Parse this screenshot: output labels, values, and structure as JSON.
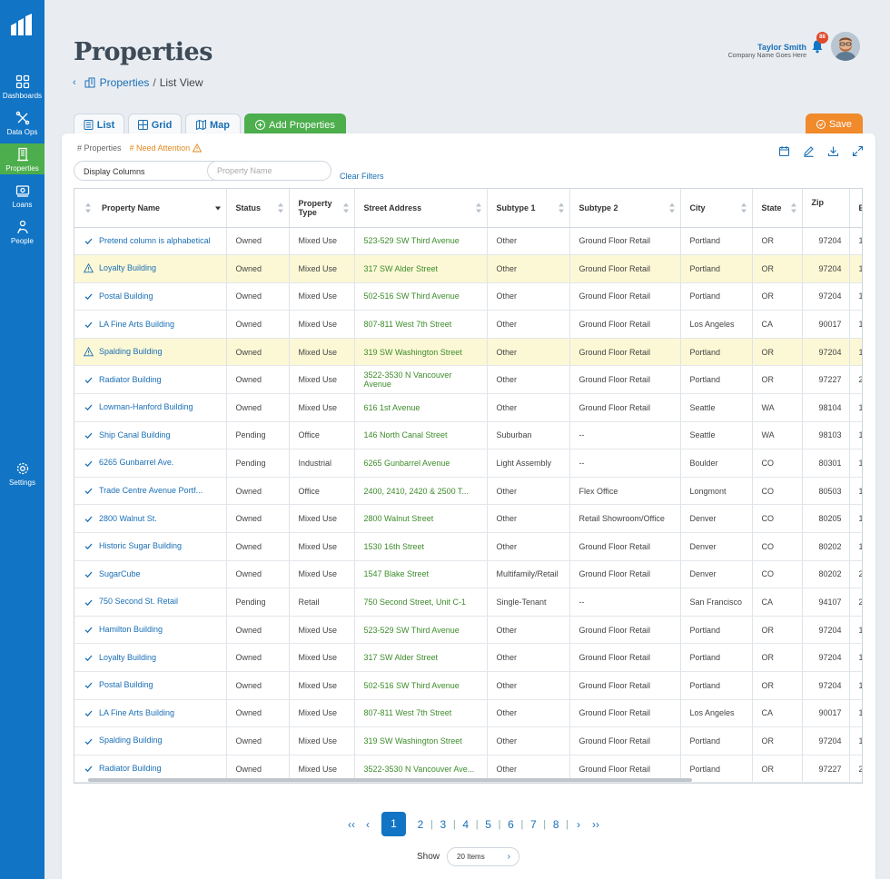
{
  "sidebar": {
    "items": [
      {
        "label": "Dashboards"
      },
      {
        "label": "Data Ops"
      },
      {
        "label": "Properties"
      },
      {
        "label": "Loans"
      },
      {
        "label": "People"
      },
      {
        "label": "Settings"
      }
    ]
  },
  "header": {
    "title": "Properties",
    "breadcrumb": {
      "back": "‹",
      "parent": "Properties",
      "separator": "/",
      "current": "List View"
    },
    "user": {
      "name": "Taylor Smith",
      "company": "Company Name Goes Here",
      "notifications": "88"
    }
  },
  "tabs": {
    "list": "List",
    "grid": "Grid",
    "map": "Map",
    "add": "Add Properties",
    "save": "Save"
  },
  "filters": {
    "properties_tag": "# Properties",
    "attention_tag": "# Need Attention",
    "display_columns": "Display Columns",
    "search_placeholder": "Property Name",
    "clear": "Clear Filters"
  },
  "table": {
    "columns": [
      "Property Name",
      "Status",
      "Property Type",
      "Street Address",
      "Subtype 1",
      "Subtype 2",
      "City",
      "State",
      "Zip",
      "E"
    ],
    "rows": [
      {
        "flag": "check",
        "name": "Pretend column is alphabetical",
        "status": "Owned",
        "type": "Mixed Use",
        "address": "523-529 SW Third Avenue",
        "subtype1": "Other",
        "subtype2": "Ground Floor Retail",
        "city": "Portland",
        "state": "OR",
        "zip": "97204",
        "e": "1"
      },
      {
        "flag": "warn",
        "name": "Loyalty Building",
        "status": "Owned",
        "type": "Mixed Use",
        "address": "317 SW Alder Street",
        "subtype1": "Other",
        "subtype2": "Ground Floor Retail",
        "city": "Portland",
        "state": "OR",
        "zip": "97204",
        "e": "1"
      },
      {
        "flag": "check",
        "name": "Postal Building",
        "status": "Owned",
        "type": "Mixed Use",
        "address": "502-516 SW Third Avenue",
        "subtype1": "Other",
        "subtype2": "Ground Floor Retail",
        "city": "Portland",
        "state": "OR",
        "zip": "97204",
        "e": "1"
      },
      {
        "flag": "check",
        "name": "LA Fine Arts Building",
        "status": "Owned",
        "type": "Mixed Use",
        "address": "807-811 West 7th Street",
        "subtype1": "Other",
        "subtype2": "Ground Floor Retail",
        "city": "Los Angeles",
        "state": "CA",
        "zip": "90017",
        "e": "1"
      },
      {
        "flag": "warn",
        "name": "Spalding Building",
        "status": "Owned",
        "type": "Mixed Use",
        "address": "319 SW Washington Street",
        "subtype1": "Other",
        "subtype2": "Ground Floor Retail",
        "city": "Portland",
        "state": "OR",
        "zip": "97204",
        "e": "1"
      },
      {
        "flag": "check",
        "name": "Radiator Building",
        "status": "Owned",
        "type": "Mixed Use",
        "address": "3522-3530 N Vancouver Avenue",
        "subtype1": "Other",
        "subtype2": "Ground Floor Retail",
        "city": "Portland",
        "state": "OR",
        "zip": "97227",
        "e": "2"
      },
      {
        "flag": "check",
        "name": "Lowman-Hanford Building",
        "status": "Owned",
        "type": "Mixed Use",
        "address": "616 1st Avenue",
        "subtype1": "Other",
        "subtype2": "Ground Floor Retail",
        "city": "Seattle",
        "state": "WA",
        "zip": "98104",
        "e": "1"
      },
      {
        "flag": "check",
        "name": "Ship Canal Building",
        "status": "Pending",
        "type": "Office",
        "address": "146 North Canal Street",
        "subtype1": "Suburban",
        "subtype2": "--",
        "city": "Seattle",
        "state": "WA",
        "zip": "98103",
        "e": "1"
      },
      {
        "flag": "check",
        "name": "6265 Gunbarrel Ave.",
        "status": "Pending",
        "type": "Industrial",
        "address": "6265 Gunbarrel Avenue",
        "subtype1": "Light Assembly",
        "subtype2": "--",
        "city": "Boulder",
        "state": "CO",
        "zip": "80301",
        "e": "1"
      },
      {
        "flag": "check",
        "name": "Trade Centre Avenue Portf...",
        "status": "Owned",
        "type": "Office",
        "address": "2400, 2410, 2420 & 2500 T...",
        "subtype1": "Other",
        "subtype2": "Flex Office",
        "city": "Longmont",
        "state": "CO",
        "zip": "80503",
        "e": "1"
      },
      {
        "flag": "check",
        "name": "2800 Walnut St.",
        "status": "Owned",
        "type": "Mixed Use",
        "address": "2800 Walnut Street",
        "subtype1": "Other",
        "subtype2": "Retail Showroom/Office",
        "city": "Denver",
        "state": "CO",
        "zip": "80205",
        "e": "1"
      },
      {
        "flag": "check",
        "name": "Historic Sugar Building",
        "status": "Owned",
        "type": "Mixed Use",
        "address": "1530 16th Street",
        "subtype1": "Other",
        "subtype2": "Ground Floor Retail",
        "city": "Denver",
        "state": "CO",
        "zip": "80202",
        "e": "1"
      },
      {
        "flag": "check",
        "name": "SugarCube",
        "status": "Owned",
        "type": "Mixed Use",
        "address": "1547 Blake Street",
        "subtype1": "Multifamily/Retail",
        "subtype2": "Ground Floor Retail",
        "city": "Denver",
        "state": "CO",
        "zip": "80202",
        "e": "2"
      },
      {
        "flag": "check",
        "name": "750 Second St. Retail",
        "status": "Pending",
        "type": "Retail",
        "address": "750 Second Street, Unit C-1",
        "subtype1": "Single-Tenant",
        "subtype2": "--",
        "city": "San Francisco",
        "state": "CA",
        "zip": "94107",
        "e": "2"
      },
      {
        "flag": "check",
        "name": "Hamilton Building",
        "status": "Owned",
        "type": "Mixed Use",
        "address": "523-529 SW Third Avenue",
        "subtype1": "Other",
        "subtype2": "Ground Floor Retail",
        "city": "Portland",
        "state": "OR",
        "zip": "97204",
        "e": "1"
      },
      {
        "flag": "check",
        "name": "Loyalty Building",
        "status": "Owned",
        "type": "Mixed Use",
        "address": "317 SW Alder Street",
        "subtype1": "Other",
        "subtype2": "Ground Floor Retail",
        "city": "Portland",
        "state": "OR",
        "zip": "97204",
        "e": "1"
      },
      {
        "flag": "check",
        "name": "Postal Building",
        "status": "Owned",
        "type": "Mixed Use",
        "address": "502-516 SW Third Avenue",
        "subtype1": "Other",
        "subtype2": "Ground Floor Retail",
        "city": "Portland",
        "state": "OR",
        "zip": "97204",
        "e": "1"
      },
      {
        "flag": "check",
        "name": "LA Fine Arts Building",
        "status": "Owned",
        "type": "Mixed Use",
        "address": "807-811 West 7th Street",
        "subtype1": "Other",
        "subtype2": "Ground Floor Retail",
        "city": "Los Angeles",
        "state": "CA",
        "zip": "90017",
        "e": "1"
      },
      {
        "flag": "check",
        "name": "Spalding Building",
        "status": "Owned",
        "type": "Mixed Use",
        "address": "319 SW Washington Street",
        "subtype1": "Other",
        "subtype2": "Ground Floor Retail",
        "city": "Portland",
        "state": "OR",
        "zip": "97204",
        "e": "1"
      },
      {
        "flag": "check",
        "name": "Radiator Building",
        "status": "Owned",
        "type": "Mixed Use",
        "address": "3522-3530 N Vancouver Ave...",
        "subtype1": "Other",
        "subtype2": "Ground Floor Retail",
        "city": "Portland",
        "state": "OR",
        "zip": "97227",
        "e": "2"
      }
    ]
  },
  "pagination": {
    "first": "‹‹",
    "prev": "‹",
    "pages": [
      "1",
      "2",
      "3",
      "4",
      "5",
      "6",
      "7",
      "8"
    ],
    "current": "1",
    "next": "›",
    "last": "››",
    "show_label": "Show",
    "per_page": "20 Items",
    "per_page_chevron": "›"
  },
  "colors": {
    "sidebar": "#1174c4",
    "active_nav": "#4cae4c",
    "link": "#1a6fb5",
    "address": "#3d8c2b",
    "attention": "#e08a1e",
    "attention_row": "#fcf8d6",
    "save": "#f08a2b"
  },
  "icons": {
    "check": "check-icon",
    "warn": "warning-icon"
  }
}
